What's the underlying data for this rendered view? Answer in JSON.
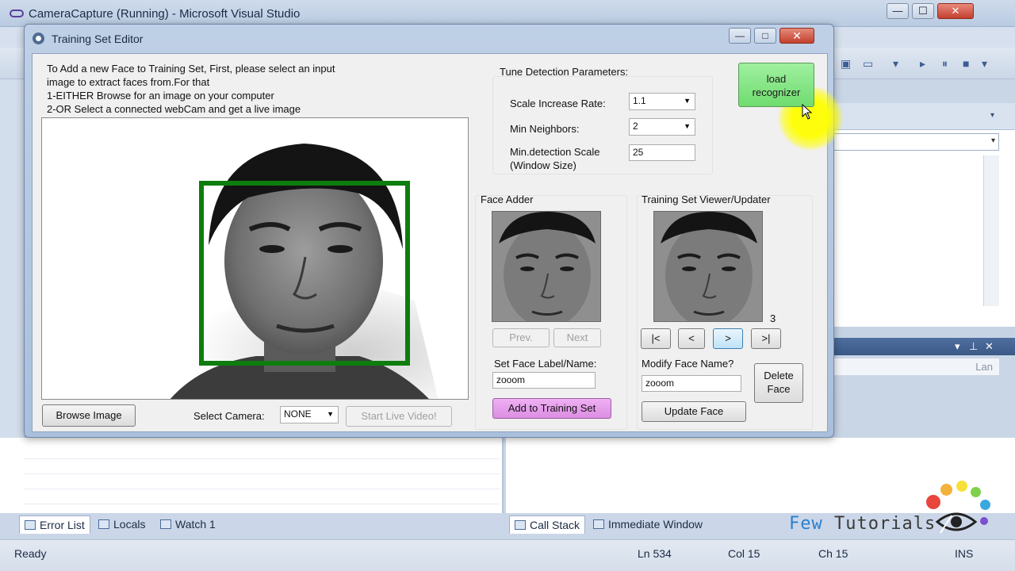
{
  "visual_studio": {
    "title": "CameraCapture (Running) - Microsoft Visual Studio",
    "title_controls": {
      "minimize": "—",
      "maximize": "☐",
      "close": "✕"
    },
    "bottom_tabs_left": [
      {
        "label": "Error List",
        "active": true
      },
      {
        "label": "Locals",
        "active": false
      },
      {
        "label": "Watch 1",
        "active": false
      }
    ],
    "bottom_tabs_right": [
      {
        "label": "Call Stack",
        "active": true
      },
      {
        "label": "Immediate Window",
        "active": false
      }
    ],
    "pane_column": "Lan",
    "status": {
      "left": "Ready",
      "line": "Ln 534",
      "col": "Col 15",
      "ch": "Ch 15",
      "mode": "INS"
    }
  },
  "editor": {
    "title": "Training Set Editor",
    "title_controls": {
      "minimize": "—",
      "maximize": "□",
      "close": "✕"
    },
    "instructions": [
      "To Add a new Face to Training Set, First, please select an input",
      "image to extract faces from.For that",
      "1-EITHER Browse for an image on your computer",
      "2-OR Select a connected webCam and get a live image"
    ],
    "browse_button": "Browse Image",
    "select_camera_label": "Select Camera:",
    "camera_value": "NONE",
    "start_video_button": "Start Live Video!",
    "tune": {
      "heading": "Tune Detection Parameters:",
      "scale_rate_label": "Scale Increase Rate:",
      "scale_rate_value": "1.1",
      "min_neighbors_label": "Min Neighbors:",
      "min_neighbors_value": "2",
      "min_scale_label_1": "Min.detection Scale",
      "min_scale_label_2": "(Window Size)",
      "min_scale_value": "25"
    },
    "load_recognizer": [
      "load",
      "recognizer"
    ],
    "face_adder": {
      "heading": "Face Adder",
      "prev_button": "Prev.",
      "next_button": "Next",
      "label_prompt": "Set Face Label/Name:",
      "label_value": "zooom",
      "add_button": "Add to Training Set"
    },
    "viewer": {
      "heading": "Training Set Viewer/Updater",
      "count": "3",
      "first_button": "|<",
      "prev_button": "<",
      "next_button": ">",
      "last_button": ">|",
      "modify_prompt": "Modify Face Name?",
      "name_value": "zooom",
      "delete_button": [
        "Delete",
        "Face"
      ],
      "update_button": "Update Face"
    }
  },
  "watermark": {
    "text_1": "Few",
    "text_2": "Tutorials"
  },
  "colors": {
    "detection_box": "#0d7d0d",
    "load_button": "#7fe07f",
    "add_button": "#e39be8",
    "cursor_highlight": "#ffff33"
  }
}
